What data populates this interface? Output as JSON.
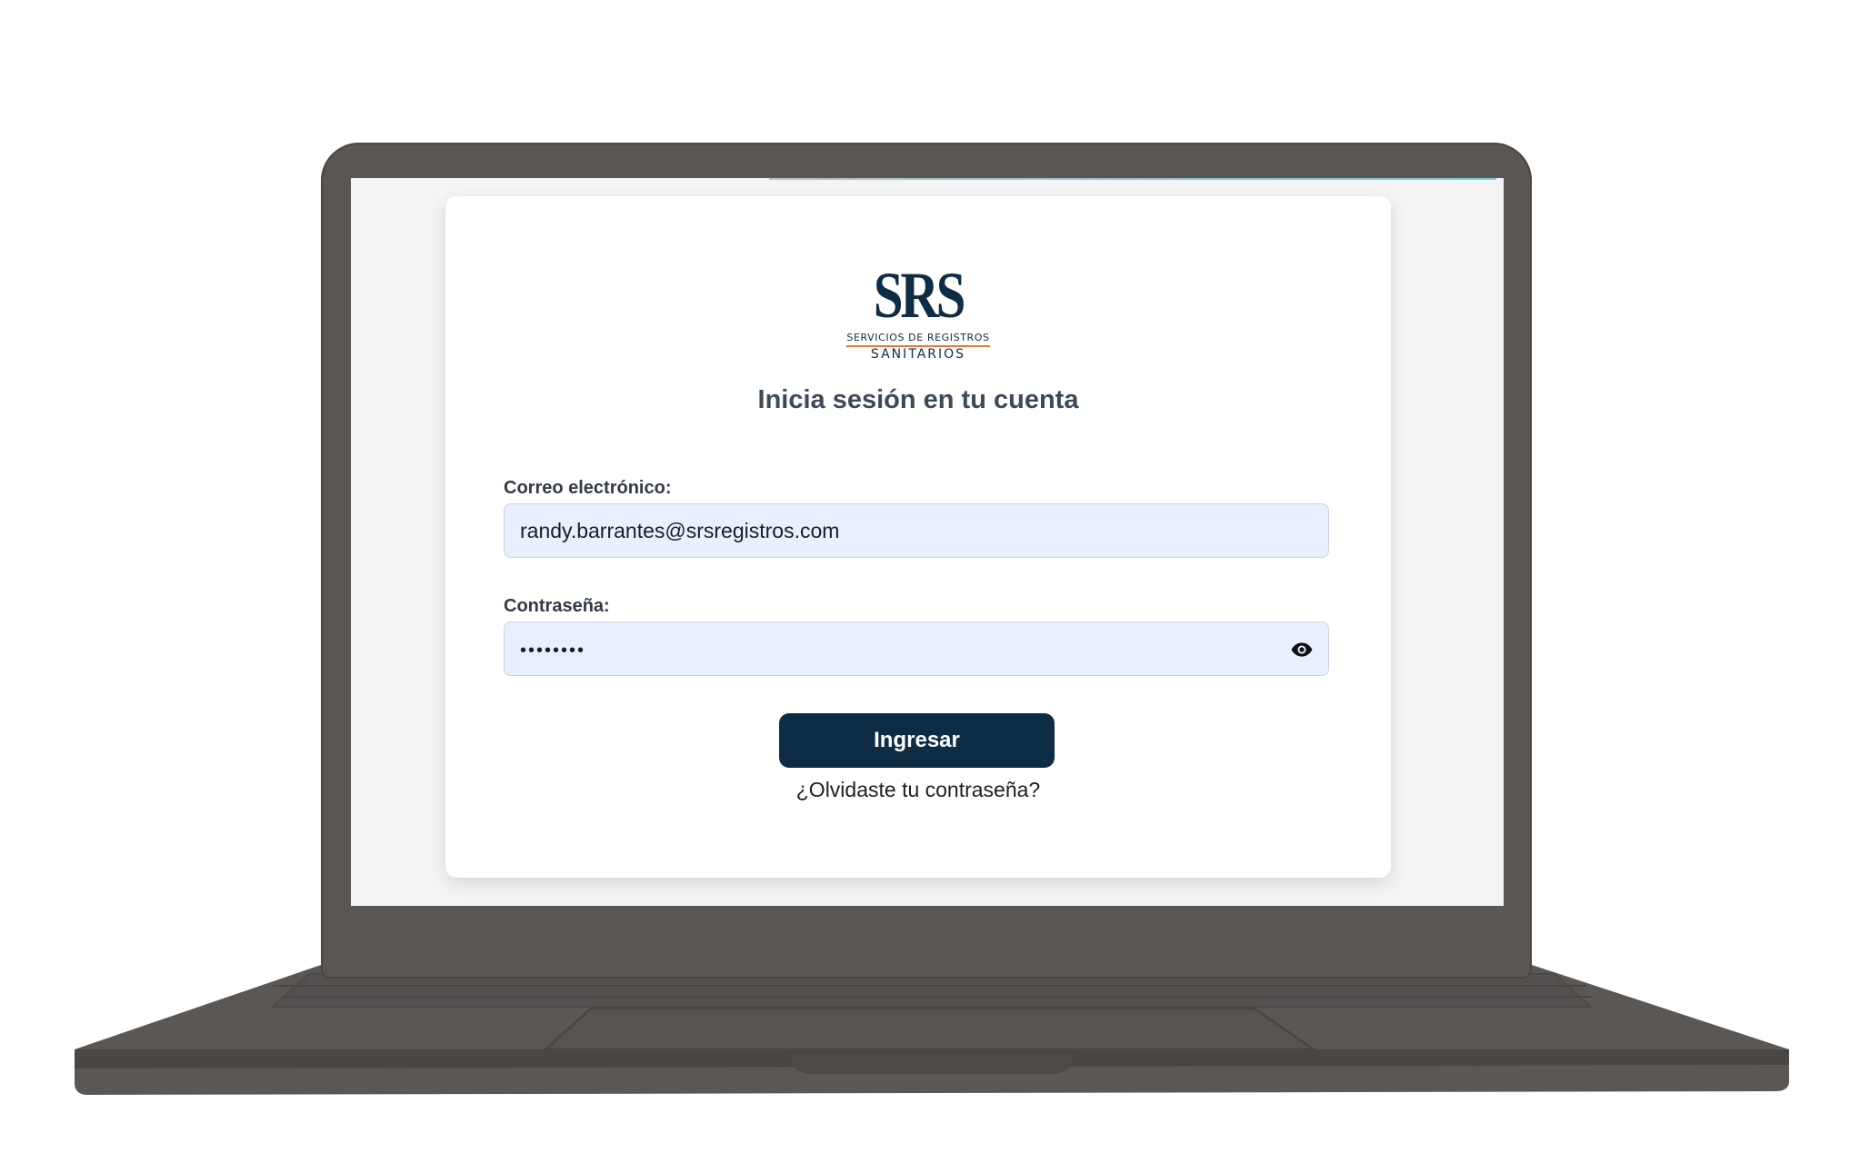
{
  "logo": {
    "mark": "SRS",
    "line1": "SERVICIOS DE REGISTROS",
    "line2": "SANITARIOS"
  },
  "login": {
    "title": "Inicia sesión en tu cuenta",
    "email_label": "Correo electrónico:",
    "email_value": "randy.barrantes@srsregistros.com",
    "password_label": "Contraseña:",
    "password_value": "••••••••",
    "submit_label": "Ingresar",
    "forgot_link": "¿Olvidaste tu contraseña?"
  },
  "icons": {
    "reveal_password": "eye-icon"
  },
  "colors": {
    "brand_navy": "#0f2c45",
    "accent_orange": "#e07a3d",
    "input_fill": "#e8effd",
    "laptop_body": "#5a5654"
  }
}
